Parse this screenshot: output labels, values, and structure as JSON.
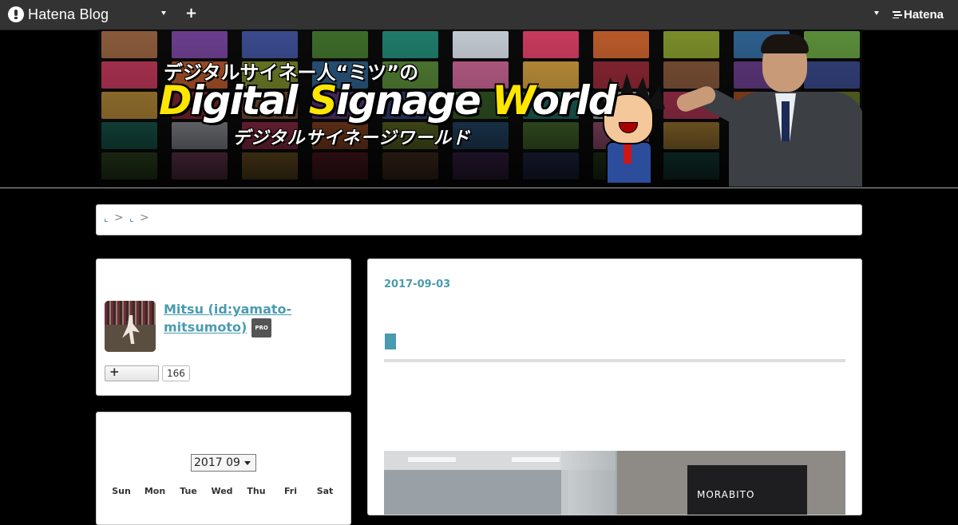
{
  "topbar": {
    "logo_text": "Hatena Blog",
    "right_brand": "Hatena"
  },
  "banner": {
    "jp_title": "デジタルサイネー人“ミツ”の",
    "en_title": {
      "d1": "D",
      "r1": "igital ",
      "d2": "S",
      "r2": "ignage ",
      "d3": "W",
      "r3": "orld"
    },
    "kana_title": "デジタルサイネージワールド",
    "accent_color": "#ffe600"
  },
  "breadcrumb": {
    "separator": ">"
  },
  "profile": {
    "author": "Mitsu (id:yamato-mitsumoto)",
    "badge": "PRO",
    "subscribe_icon": "+",
    "subscriber_count": "166"
  },
  "calendar": {
    "selected_month": "2017 09",
    "weekdays": [
      "Sun",
      "Mon",
      "Tue",
      "Wed",
      "Thu",
      "Fri",
      "Sat"
    ]
  },
  "article": {
    "date": "2017-09-03",
    "photo_sign": "MORABITO"
  },
  "colors": {
    "link": "#4a9bb0",
    "topbar": "#333333",
    "background": "#000000"
  }
}
